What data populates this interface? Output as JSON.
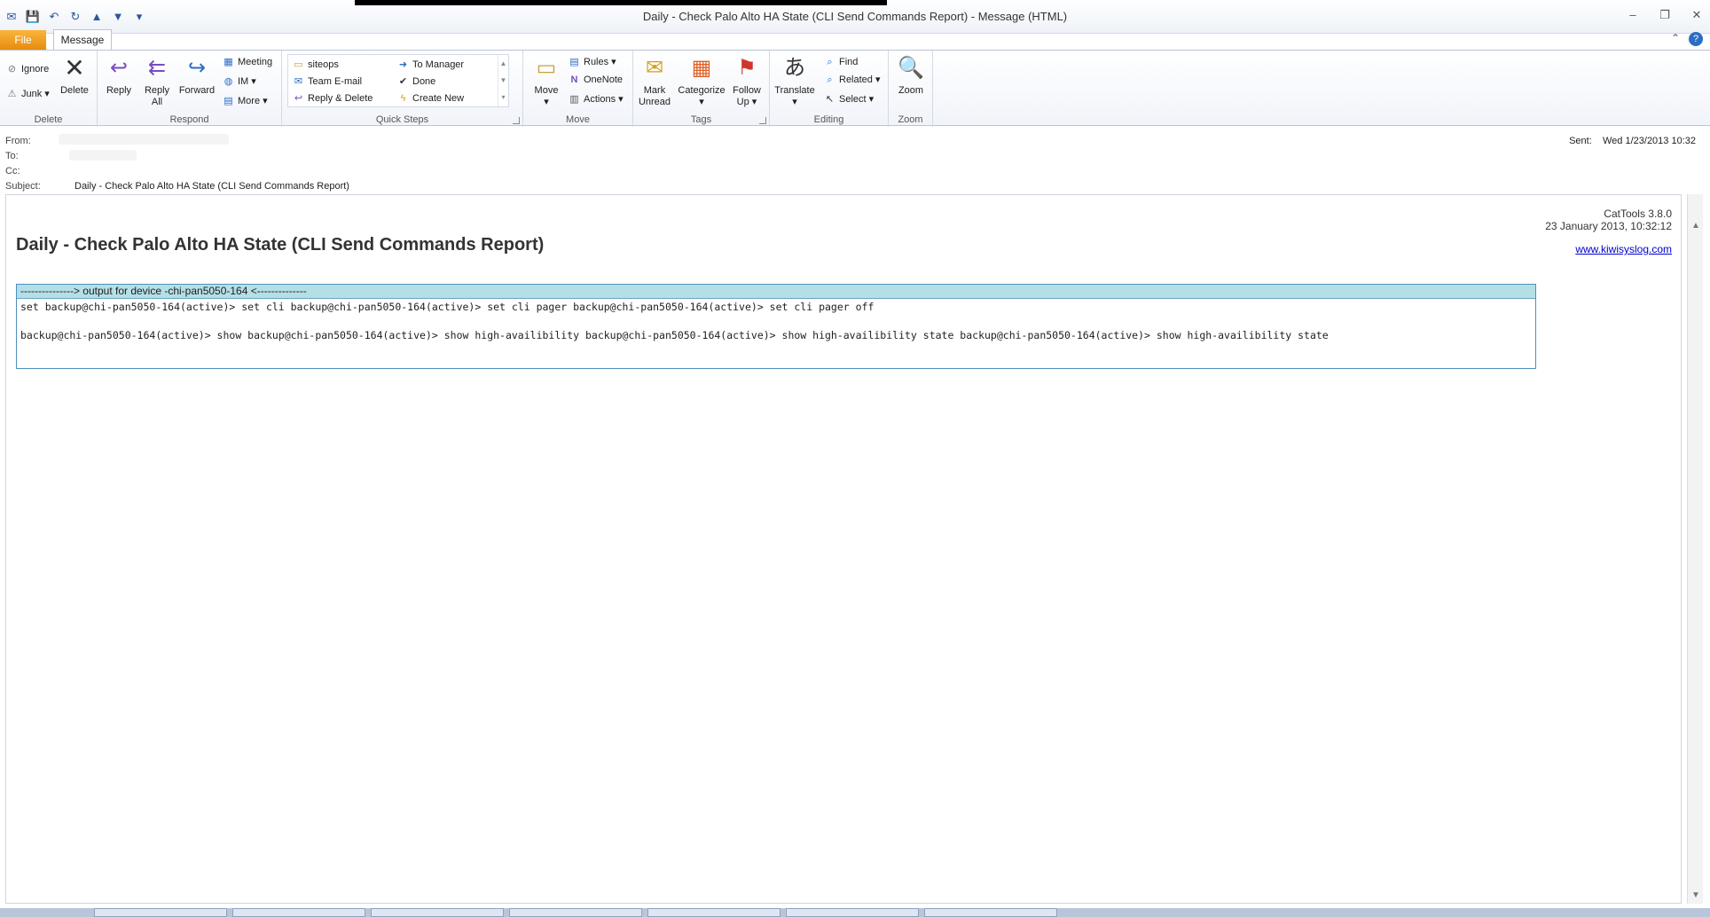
{
  "window": {
    "title": "Daily - Check Palo Alto HA State (CLI Send Commands Report)  -  Message (HTML)"
  },
  "tabs": {
    "file": "File",
    "message": "Message"
  },
  "ribbon": {
    "delete": {
      "label": "Delete",
      "ignore": "Ignore",
      "junk": "Junk",
      "delete_btn": "Delete"
    },
    "respond": {
      "label": "Respond",
      "reply": "Reply",
      "reply_all_1": "Reply",
      "reply_all_2": "All",
      "forward": "Forward",
      "meeting": "Meeting",
      "im": "IM",
      "more": "More"
    },
    "quick_steps": {
      "label": "Quick Steps",
      "items": [
        "siteops",
        "Team E-mail",
        "Reply & Delete",
        "To Manager",
        "Done",
        "Create New"
      ]
    },
    "move": {
      "label": "Move",
      "move_btn": "Move",
      "rules": "Rules",
      "onenote": "OneNote",
      "actions": "Actions"
    },
    "tags": {
      "label": "Tags",
      "mark_unread_1": "Mark",
      "mark_unread_2": "Unread",
      "categorize": "Categorize",
      "follow_up_1": "Follow",
      "follow_up_2": "Up"
    },
    "editing": {
      "label": "Editing",
      "translate": "Translate",
      "find": "Find",
      "related": "Related",
      "select": "Select"
    },
    "zoom": {
      "label": "Zoom",
      "zoom_btn": "Zoom"
    }
  },
  "header": {
    "from_label": "From:",
    "to_label": "To:",
    "cc_label": "Cc:",
    "subject_label": "Subject:",
    "subject": "Daily - Check Palo Alto HA State (CLI Send Commands Report)",
    "sent_label": "Sent:",
    "sent_value": "Wed 1/23/2013 10:32"
  },
  "body": {
    "report_title": "Daily - Check Palo Alto HA State (CLI Send Commands Report)",
    "cattools_version": "CatTools 3.8.0",
    "report_datetime": "23 January 2013, 10:32:12",
    "website": "www.kiwisyslog.com",
    "output_header": "---------------> output for device -chi-pan5050-164 <--------------",
    "output_line_1": "set backup@chi-pan5050-164(active)> set cli backup@chi-pan5050-164(active)> set cli pager backup@chi-pan5050-164(active)> set cli pager off",
    "output_line_2": "backup@chi-pan5050-164(active)> show backup@chi-pan5050-164(active)> show high-availibility backup@chi-pan5050-164(active)> show high-availibility state backup@chi-pan5050-164(active)> show high-availibility state"
  }
}
